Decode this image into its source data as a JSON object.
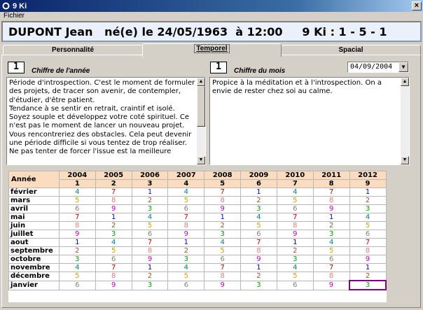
{
  "window": {
    "title": "9 Ki",
    "close": "×"
  },
  "menu": {
    "fichier": "Fichier"
  },
  "header": {
    "text": "DUPONT Jean   né(e) le 24/05/1963  à 12:00     9 Ki : 1 - 5 - 1"
  },
  "tabs": [
    {
      "label": "Personnalité"
    },
    {
      "label": "Temporel"
    },
    {
      "label": "Spacial"
    }
  ],
  "year_panel": {
    "number": "1",
    "caption": "Chiffre de l'année",
    "text": "Période d'introspection. C'est le moment de formuler des projets, de tracer son avenir, de contempler, d'étudier, d'être patient.\nTendance à se sentir en retrait, craintif et isolé.\nSoyez souple et développez votre coté spirituel. Ce n'est pas le moment de lancer un nouveau projet.\nVous rencontreriez des obstacles. Cela peut devenir une période difficile si vous tentez de trop réaliser.\nNe pas tenter de forcer l'issue est la meilleure"
  },
  "month_panel": {
    "number": "1",
    "caption": "Chiffre du mois",
    "date": "04/09/2004",
    "text": "Propice à la méditation et à l'introspection. On a envie de rester chez soi au calme."
  },
  "colors": {
    "1": "#0000c8",
    "2": "#a0522d",
    "3": "#00a000",
    "4": "#008080",
    "5": "#d4a000",
    "6": "#808080",
    "7": "#c80000",
    "8": "#e08080",
    "9": "#c000c0"
  },
  "grid": {
    "corner": "Année",
    "years": [
      "2004",
      "2005",
      "2006",
      "2007",
      "2008",
      "2009",
      "2010",
      "2011",
      "2012"
    ],
    "year_numbers": [
      "1",
      "2",
      "3",
      "4",
      "5",
      "6",
      "7",
      "8",
      "9"
    ],
    "months": [
      "février",
      "mars",
      "avril",
      "mai",
      "juin",
      "juillet",
      "aout",
      "septembre",
      "octobre",
      "novembre",
      "décembre",
      "janvier"
    ],
    "values": [
      [
        "4",
        "7",
        "1",
        "4",
        "7",
        "1",
        "4",
        "7",
        "1"
      ],
      [
        "5",
        "8",
        "2",
        "5",
        "8",
        "2",
        "5",
        "8",
        "2"
      ],
      [
        "6",
        "9",
        "3",
        "6",
        "9",
        "3",
        "6",
        "9",
        "3"
      ],
      [
        "7",
        "1",
        "4",
        "7",
        "1",
        "4",
        "7",
        "1",
        "4"
      ],
      [
        "8",
        "2",
        "5",
        "8",
        "2",
        "5",
        "8",
        "2",
        "5"
      ],
      [
        "9",
        "3",
        "6",
        "9",
        "3",
        "6",
        "9",
        "3",
        "6"
      ],
      [
        "1",
        "4",
        "7",
        "1",
        "4",
        "7",
        "1",
        "4",
        "7"
      ],
      [
        "2",
        "5",
        "8",
        "2",
        "5",
        "8",
        "2",
        "5",
        "8"
      ],
      [
        "3",
        "6",
        "9",
        "3",
        "6",
        "9",
        "3",
        "6",
        "9"
      ],
      [
        "4",
        "7",
        "1",
        "4",
        "7",
        "1",
        "4",
        "7",
        "1"
      ],
      [
        "5",
        "8",
        "2",
        "5",
        "8",
        "2",
        "5",
        "8",
        "2"
      ],
      [
        "6",
        "9",
        "3",
        "6",
        "9",
        "3",
        "6",
        "9",
        "3"
      ]
    ],
    "selected": [
      11,
      8
    ]
  }
}
